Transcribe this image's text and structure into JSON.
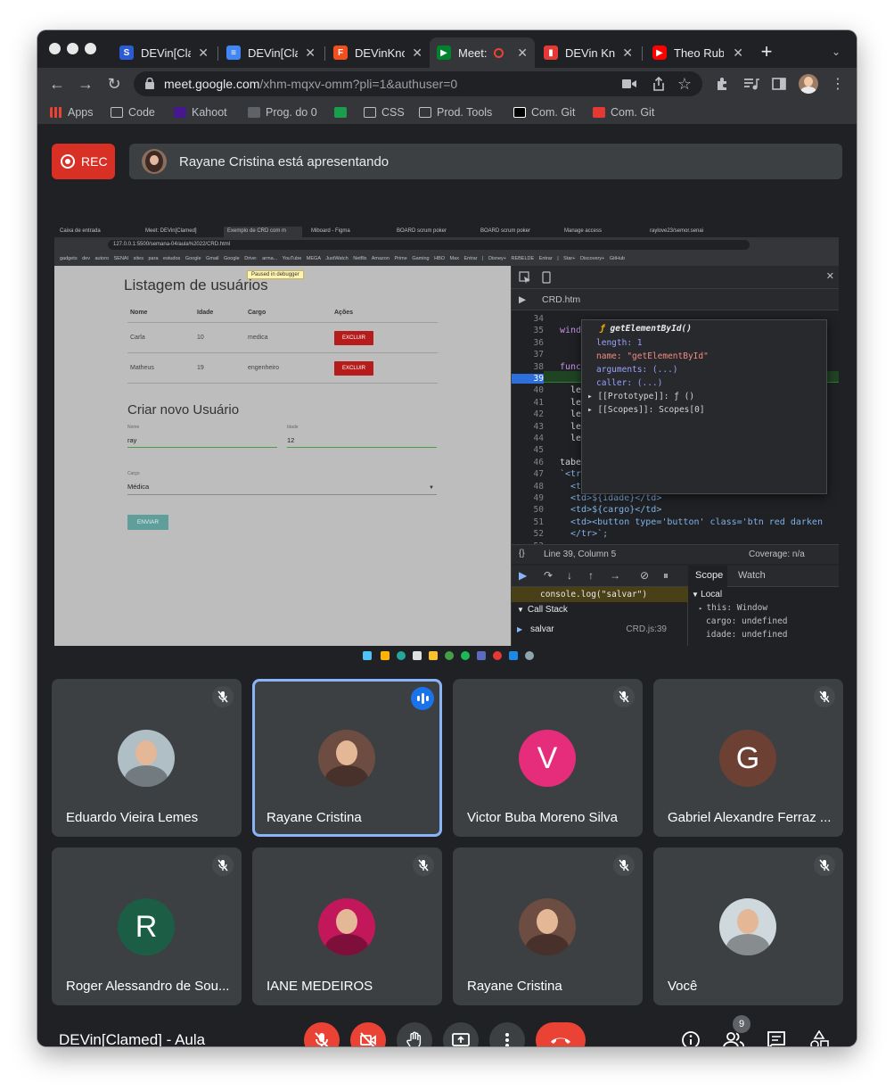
{
  "browser": {
    "tabs": [
      {
        "title": "DEVin[Cla",
        "favicon": "S",
        "favicon_color": "#2b5cd6"
      },
      {
        "title": "DEVin[Cla",
        "favicon": "doc",
        "favicon_color": "#4285f4"
      },
      {
        "title": "DEVinKno",
        "favicon": "figma",
        "favicon_color": "#f24e1e"
      },
      {
        "title": "Meet:",
        "favicon": "meet",
        "favicon_color": "#00832d"
      },
      {
        "title": "DEVin Kn",
        "favicon": "bookmark",
        "favicon_color": "#e53935"
      },
      {
        "title": "Theo Rub",
        "favicon": "youtube",
        "favicon_color": "#ff0000"
      }
    ],
    "url_domain": "meet.google.com",
    "url_path": "/xhm-mqxv-omm?pli=1&authuser=0",
    "bookmarks": [
      "Apps",
      "Code",
      "Kahoot",
      "Prog. do 0",
      "CSS",
      "Prod. Tools",
      "Com. Git",
      "Com. Git"
    ]
  },
  "meet": {
    "rec_label": "REC",
    "presenter_text": "Rayane Cristina está apresentando",
    "meeting_title": "DEVin[Clamed] - Aula",
    "participant_count": "9",
    "participants": [
      {
        "name": "Eduardo Vieira Lemes",
        "initial": "",
        "color": "#b0bec5",
        "muted": true
      },
      {
        "name": "Rayane Cristina",
        "initial": "",
        "color": "#6d4c41",
        "muted": false,
        "speaking": true
      },
      {
        "name": "Victor Buba Moreno Silva",
        "initial": "V",
        "color": "#e52d7b",
        "muted": true
      },
      {
        "name": "Gabriel Alexandre Ferraz ...",
        "initial": "G",
        "color": "#6d4034",
        "muted": true
      },
      {
        "name": "Roger Alessandro de Sou...",
        "initial": "R",
        "color": "#1b5e45",
        "muted": true
      },
      {
        "name": "IANE MEDEIROS",
        "initial": "",
        "color": "#c2185b",
        "muted": true
      },
      {
        "name": "Rayane Cristina",
        "initial": "",
        "color": "#6d4c41",
        "muted": true
      },
      {
        "name": "Você",
        "initial": "",
        "color": "#cfd8dc",
        "muted": true
      }
    ]
  },
  "shared_screen": {
    "inner_tabs": [
      "Caixa de entrada",
      "Meet: DEVin[Clamed]",
      "Exemplo de CRD com m",
      "Miboard - Figma",
      "BOARD scrum poker",
      "BOARD scrum poker",
      "Manage access",
      "raylove23/semor.senai"
    ],
    "inner_url": "127.0.0.1:5500/semana-04/aula%2022/CRD.html",
    "inner_bookmarks": "gadgets dev   autoro   SENAI   sites para estudos   Google   Gmail   Google Drive: arma...   YouTube   MEGA   JustWatch   Netflix   Amazon   Prime Gaming   HBO Max   Entrar | Disney+   REBELDE   Entrar | Star+   Discovery+   GitHub",
    "paused_text": "Paused in debugger",
    "page_title": "Listagem de usuários",
    "table_headers": [
      "Nome",
      "Idade",
      "Cargo",
      "Ações"
    ],
    "table_rows": [
      {
        "nome": "Carla",
        "idade": "10",
        "cargo": "medica",
        "acao": "EXCLUIR"
      },
      {
        "nome": "Matheus",
        "idade": "19",
        "cargo": "engenheiro",
        "acao": "EXCLUIR"
      }
    ],
    "form_title": "Criar novo Usuário",
    "nome_label": "Nome",
    "nome_value": "ray",
    "idade_label": "Idade",
    "idade_value": "12",
    "cargo_label": "Cargo",
    "cargo_value": "Médica",
    "submit_label": "ENVIAR",
    "devtools": {
      "file_tab": "CRD.htm",
      "popup_title": "getElementById()",
      "popup_lines": [
        "length: 1",
        "name: \"getElementById\"",
        "arguments: (...)",
        "caller: (...)",
        "[[Prototype]]: ƒ ()",
        "[[Scopes]]: Scopes[0]"
      ],
      "line_numbers": [
        "34",
        "35",
        "36",
        "37",
        "38",
        "39",
        "40",
        "41",
        "42",
        "43",
        "44",
        "45",
        "46",
        "47",
        "48",
        "49",
        "50",
        "51",
        "52",
        "53"
      ],
      "code_lines": [
        "",
        "wind",
        "",
        "",
        "func",
        "",
        "le",
        "le",
        "le",
        "le",
        "le",
        "",
        "tabela.innerHTML +=",
        "`<tr>",
        "<td>${nome}</td>",
        "<td>${idade}</td>",
        "<td>${cargo}</td>",
        "<td><button type='button' class='btn red darken",
        "</tr>`;",
        ""
      ],
      "status_position": "Line 39, Column 5",
      "coverage": "Coverage: n/a",
      "scope_tab": "Scope",
      "watch_tab": "Watch",
      "watch_expr": "console.log(\"salvar\")",
      "call_stack_label": "Call Stack",
      "frame_name": "salvar",
      "frame_loc": "CRD.js:39",
      "scope_local": "Local",
      "scope_lines": [
        "this: Window",
        "cargo: undefined",
        "idade: undefined"
      ]
    }
  }
}
